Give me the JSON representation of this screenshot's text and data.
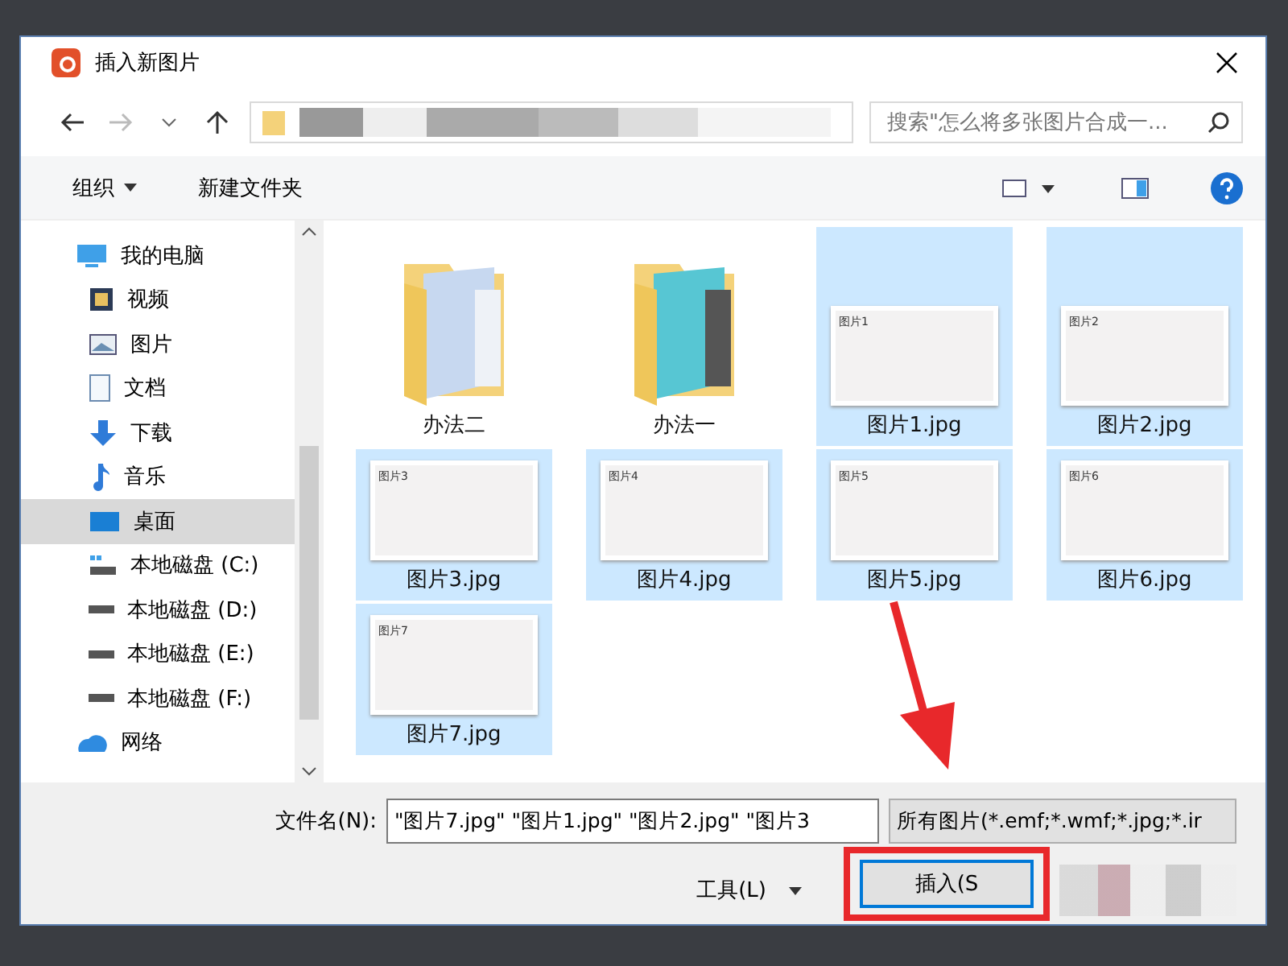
{
  "window": {
    "title": "插入新图片"
  },
  "search": {
    "placeholder": "搜索\"怎么将多张图片合成一..."
  },
  "toolbar": {
    "organize": "组织",
    "new_folder": "新建文件夹"
  },
  "sidebar": {
    "items": [
      {
        "label": "我的电脑",
        "kind": "computer",
        "selected": false,
        "children": [
          {
            "label": "视频",
            "kind": "video",
            "selected": false
          },
          {
            "label": "图片",
            "kind": "pictures",
            "selected": false
          },
          {
            "label": "文档",
            "kind": "documents",
            "selected": false
          },
          {
            "label": "下载",
            "kind": "download",
            "selected": false
          },
          {
            "label": "音乐",
            "kind": "music",
            "selected": false
          },
          {
            "label": "桌面",
            "kind": "desktop",
            "selected": true
          },
          {
            "label": "本地磁盘 (C:)",
            "kind": "system-drive",
            "selected": false
          },
          {
            "label": "本地磁盘 (D:)",
            "kind": "drive",
            "selected": false
          },
          {
            "label": "本地磁盘 (E:)",
            "kind": "drive",
            "selected": false
          },
          {
            "label": "本地磁盘 (F:)",
            "kind": "drive",
            "selected": false
          }
        ]
      },
      {
        "label": "网络",
        "kind": "network",
        "selected": false
      }
    ]
  },
  "files": [
    {
      "name": "办法二",
      "kind": "folder",
      "selected": false
    },
    {
      "name": "办法一",
      "kind": "folder",
      "selected": false
    },
    {
      "name": "图片1.jpg",
      "kind": "image",
      "thumb": "图片1",
      "selected": true
    },
    {
      "name": "图片2.jpg",
      "kind": "image",
      "thumb": "图片2",
      "selected": true
    },
    {
      "name": "图片3.jpg",
      "kind": "image",
      "thumb": "图片3",
      "selected": true
    },
    {
      "name": "图片4.jpg",
      "kind": "image",
      "thumb": "图片4",
      "selected": true
    },
    {
      "name": "图片5.jpg",
      "kind": "image",
      "thumb": "图片5",
      "selected": true
    },
    {
      "name": "图片6.jpg",
      "kind": "image",
      "thumb": "图片6",
      "selected": true
    },
    {
      "name": "图片7.jpg",
      "kind": "image",
      "thumb": "图片7",
      "selected": true
    }
  ],
  "footer": {
    "filename_label": "文件名(N):",
    "filename": "\"图片7.jpg\" \"图片1.jpg\" \"图片2.jpg\" \"图片3",
    "filter": "所有图片(*.emf;*.wmf;*.jpg;*.ir",
    "tools": "工具(L)",
    "insert": "插入(S"
  }
}
